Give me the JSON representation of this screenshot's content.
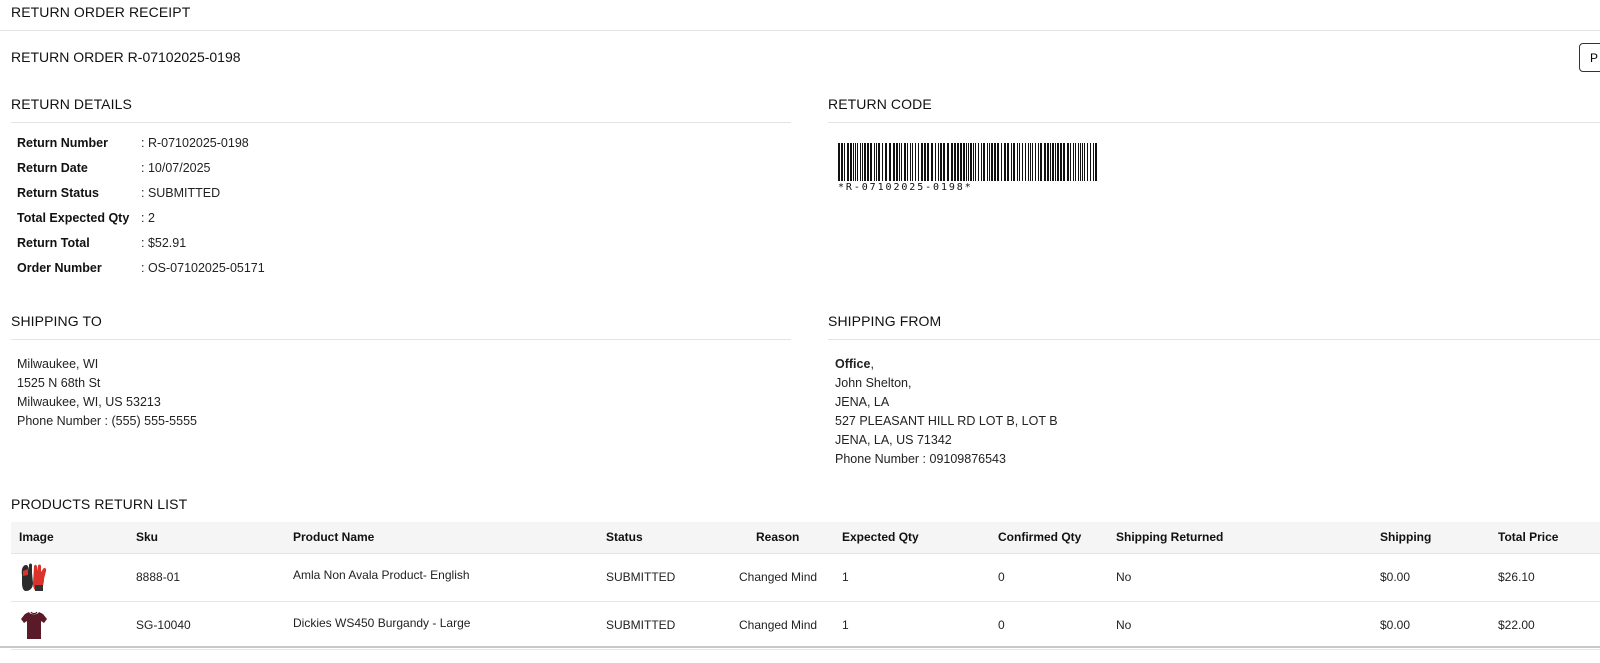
{
  "page": {
    "title": "RETURN ORDER RECEIPT",
    "order_heading": "RETURN ORDER R-07102025-0198",
    "print_label": "P"
  },
  "return_details": {
    "heading": "RETURN DETAILS",
    "fields": [
      {
        "label": "Return Number",
        "value": ": R-07102025-0198"
      },
      {
        "label": "Return Date",
        "value": ": 10/07/2025"
      },
      {
        "label": "Return Status",
        "value": ": SUBMITTED"
      },
      {
        "label": "Total Expected Qty",
        "value": ": 2"
      },
      {
        "label": "Return Total",
        "value": ": $52.91"
      },
      {
        "label": "Order Number",
        "value": ": OS-07102025-05171"
      }
    ]
  },
  "return_code": {
    "heading": "RETURN CODE",
    "barcode_text": "*R-07102025-0198*"
  },
  "shipping_to": {
    "heading": "SHIPPING TO",
    "lines": [
      "Milwaukee, WI",
      "1525 N 68th St",
      "Milwaukee, WI, US 53213",
      "Phone Number : (555) 555-5555"
    ]
  },
  "shipping_from": {
    "heading": "SHIPPING FROM",
    "company": "Office",
    "company_suffix": ",",
    "lines": [
      "John Shelton,",
      "JENA, LA",
      "527 PLEASANT HILL RD LOT B, LOT B",
      "JENA, LA, US 71342",
      "Phone Number : 09109876543"
    ]
  },
  "products": {
    "heading": "PRODUCTS RETURN LIST",
    "columns": {
      "image": "Image",
      "sku": "Sku",
      "name": "Product Name",
      "status": "Status",
      "reason": "Reason",
      "expected": "Expected Qty",
      "confirmed": "Confirmed Qty",
      "shipping_returned": "Shipping Returned",
      "shipping": "Shipping",
      "total": "Total Price"
    },
    "rows": [
      {
        "image_icon": "gloves-icon",
        "sku": "8888-01",
        "name": "Amla Non Avala Product- English",
        "status": "SUBMITTED",
        "reason": "Changed Mind",
        "expected": "1",
        "confirmed": "0",
        "shipping_returned": "No",
        "shipping": "$0.00",
        "total": "$26.10"
      },
      {
        "image_icon": "shirt-icon",
        "sku": "SG-10040",
        "name": "Dickies WS450 Burgandy - Large",
        "status": "SUBMITTED",
        "reason": "Changed Mind",
        "expected": "1",
        "confirmed": "0",
        "shipping_returned": "No",
        "shipping": "$0.00",
        "total": "$22.00"
      }
    ]
  },
  "colors": {
    "header_bg": "#f5f5f5",
    "rule": "#e4e4e4",
    "glove_red": "#d9332b",
    "shirt_burgundy": "#5a1a28"
  }
}
